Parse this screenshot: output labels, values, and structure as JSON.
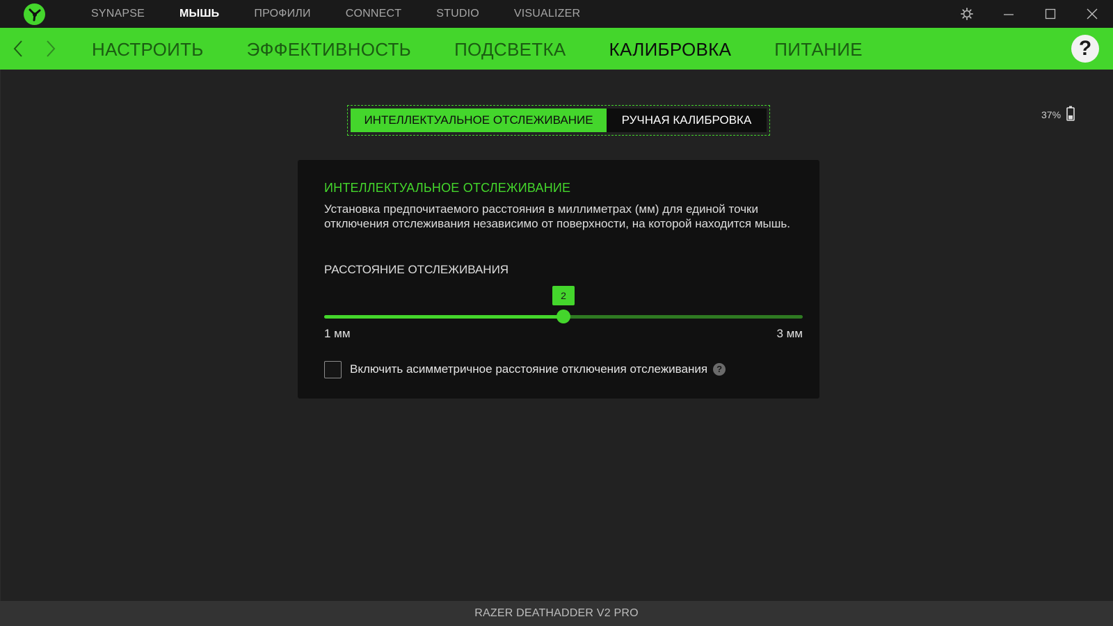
{
  "colors": {
    "accent": "#44d62c",
    "background": "#222222",
    "topbar": "#1a1a1a",
    "card": "#111111",
    "footer": "#333333"
  },
  "topnav": {
    "items": [
      {
        "label": "SYNAPSE",
        "active": false
      },
      {
        "label": "МЫШЬ",
        "active": true
      },
      {
        "label": "ПРОФИЛИ",
        "active": false
      },
      {
        "label": "CONNECT",
        "active": false
      },
      {
        "label": "STUDIO",
        "active": false
      },
      {
        "label": "VISUALIZER",
        "active": false
      }
    ],
    "icons": [
      "razer-logo-icon",
      "settings-gear-icon",
      "minimize-icon",
      "maximize-icon",
      "close-icon"
    ]
  },
  "subnav": {
    "tabs": [
      {
        "label": "НАСТРОИТЬ",
        "active": false
      },
      {
        "label": "ЭФФЕКТИВНОСТЬ",
        "active": false
      },
      {
        "label": "ПОДСВЕТКА",
        "active": false
      },
      {
        "label": "КАЛИБРОВКА",
        "active": true
      },
      {
        "label": "ПИТАНИЕ",
        "active": false
      }
    ],
    "help_label": "?"
  },
  "segment": {
    "active_label": "ИНТЕЛЛЕКТУАЛЬНОЕ ОТСЛЕЖИВАНИЕ",
    "inactive_label": "РУЧНАЯ КАЛИБРОВКА"
  },
  "battery": {
    "percent_label": "37%",
    "level": 0.37
  },
  "card": {
    "title": "ИНТЕЛЛЕКТУАЛЬНОЕ ОТСЛЕЖИВАНИЕ",
    "description": "Установка предпочитаемого расстояния в миллиметрах (мм) для единой точки отключения отслеживания независимо от поверхности, на которой находится мышь.",
    "section_label": "РАССТОЯНИЕ ОТСЛЕЖИВАНИЯ",
    "slider": {
      "min": 1,
      "max": 3,
      "value": 2,
      "value_label": "2",
      "min_label": "1 мм",
      "max_label": "3 мм"
    },
    "checkbox": {
      "label": "Включить асимметричное расстояние отключения отслеживания",
      "checked": false,
      "help_label": "?"
    }
  },
  "footer": {
    "device_name": "RAZER DEATHADDER V2 PRO"
  }
}
